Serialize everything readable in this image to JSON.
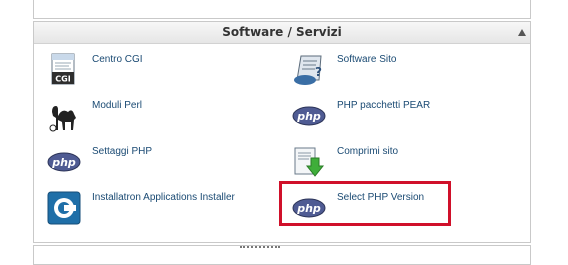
{
  "panel": {
    "title": "Software / Servizi"
  },
  "items": [
    {
      "label": "Centro CGI",
      "icon": "cgi-script-icon"
    },
    {
      "label": "Software Sito",
      "icon": "software-script-icon"
    },
    {
      "label": "Moduli Perl",
      "icon": "perl-camel-icon"
    },
    {
      "label": "PHP pacchetti PEAR",
      "icon": "php-logo-icon"
    },
    {
      "label": "Settaggi PHP",
      "icon": "php-logo-icon"
    },
    {
      "label": "Comprimi sito",
      "icon": "compress-icon"
    },
    {
      "label": "Installatron Applications Installer",
      "icon": "installatron-icon"
    },
    {
      "label": "Select PHP Version",
      "icon": "php-logo-icon"
    }
  ],
  "icon_text": {
    "cgi": "CGI",
    "php": "php"
  },
  "colors": {
    "highlight": "#d0102a",
    "link": "#1a4a73",
    "php_oval": "#4f5b93"
  }
}
